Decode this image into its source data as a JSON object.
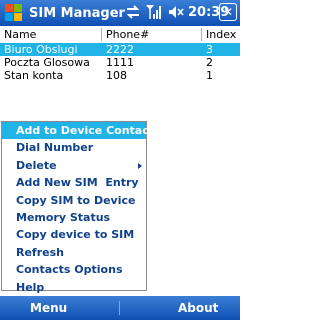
{
  "titlebar": {
    "app_title": "SIM Manager",
    "clock": "20:39",
    "close_label": "✕",
    "icons": [
      "sync-icon",
      "signal-icon",
      "speaker-muted-icon"
    ]
  },
  "table": {
    "columns": [
      "Name",
      "Phone#",
      "Index"
    ],
    "rows": [
      {
        "name": "Biuro Obslugi",
        "phone": "2222",
        "index": "3",
        "selected": true
      },
      {
        "name": "Poczta Glosowa",
        "phone": "1111",
        "index": "2",
        "selected": false
      },
      {
        "name": "Stan konta",
        "phone": "108",
        "index": "1",
        "selected": false
      }
    ]
  },
  "menu": {
    "items": [
      {
        "label": "Add to Device Contact",
        "highlight": true,
        "submenu": false
      },
      {
        "label": "Dial Number",
        "highlight": false,
        "submenu": false
      },
      {
        "label": "Delete",
        "highlight": false,
        "submenu": true
      },
      {
        "label": "Add New SIM  Entry",
        "highlight": false,
        "submenu": false
      },
      {
        "label": "Copy SIM to Device",
        "highlight": false,
        "submenu": false
      },
      {
        "label": "Memory Status",
        "highlight": false,
        "submenu": false
      },
      {
        "label": "Copy device to SIM",
        "highlight": false,
        "submenu": false
      },
      {
        "label": "Refresh",
        "highlight": false,
        "submenu": false
      },
      {
        "label": "Contacts Options",
        "highlight": false,
        "submenu": false
      },
      {
        "label": "Help",
        "highlight": false,
        "submenu": false
      }
    ]
  },
  "softkeys": {
    "left": "Menu",
    "right": "About"
  },
  "colors": {
    "bar": "#0f4fb3",
    "selection": "#20b3e6",
    "menu_text": "#10418c"
  }
}
